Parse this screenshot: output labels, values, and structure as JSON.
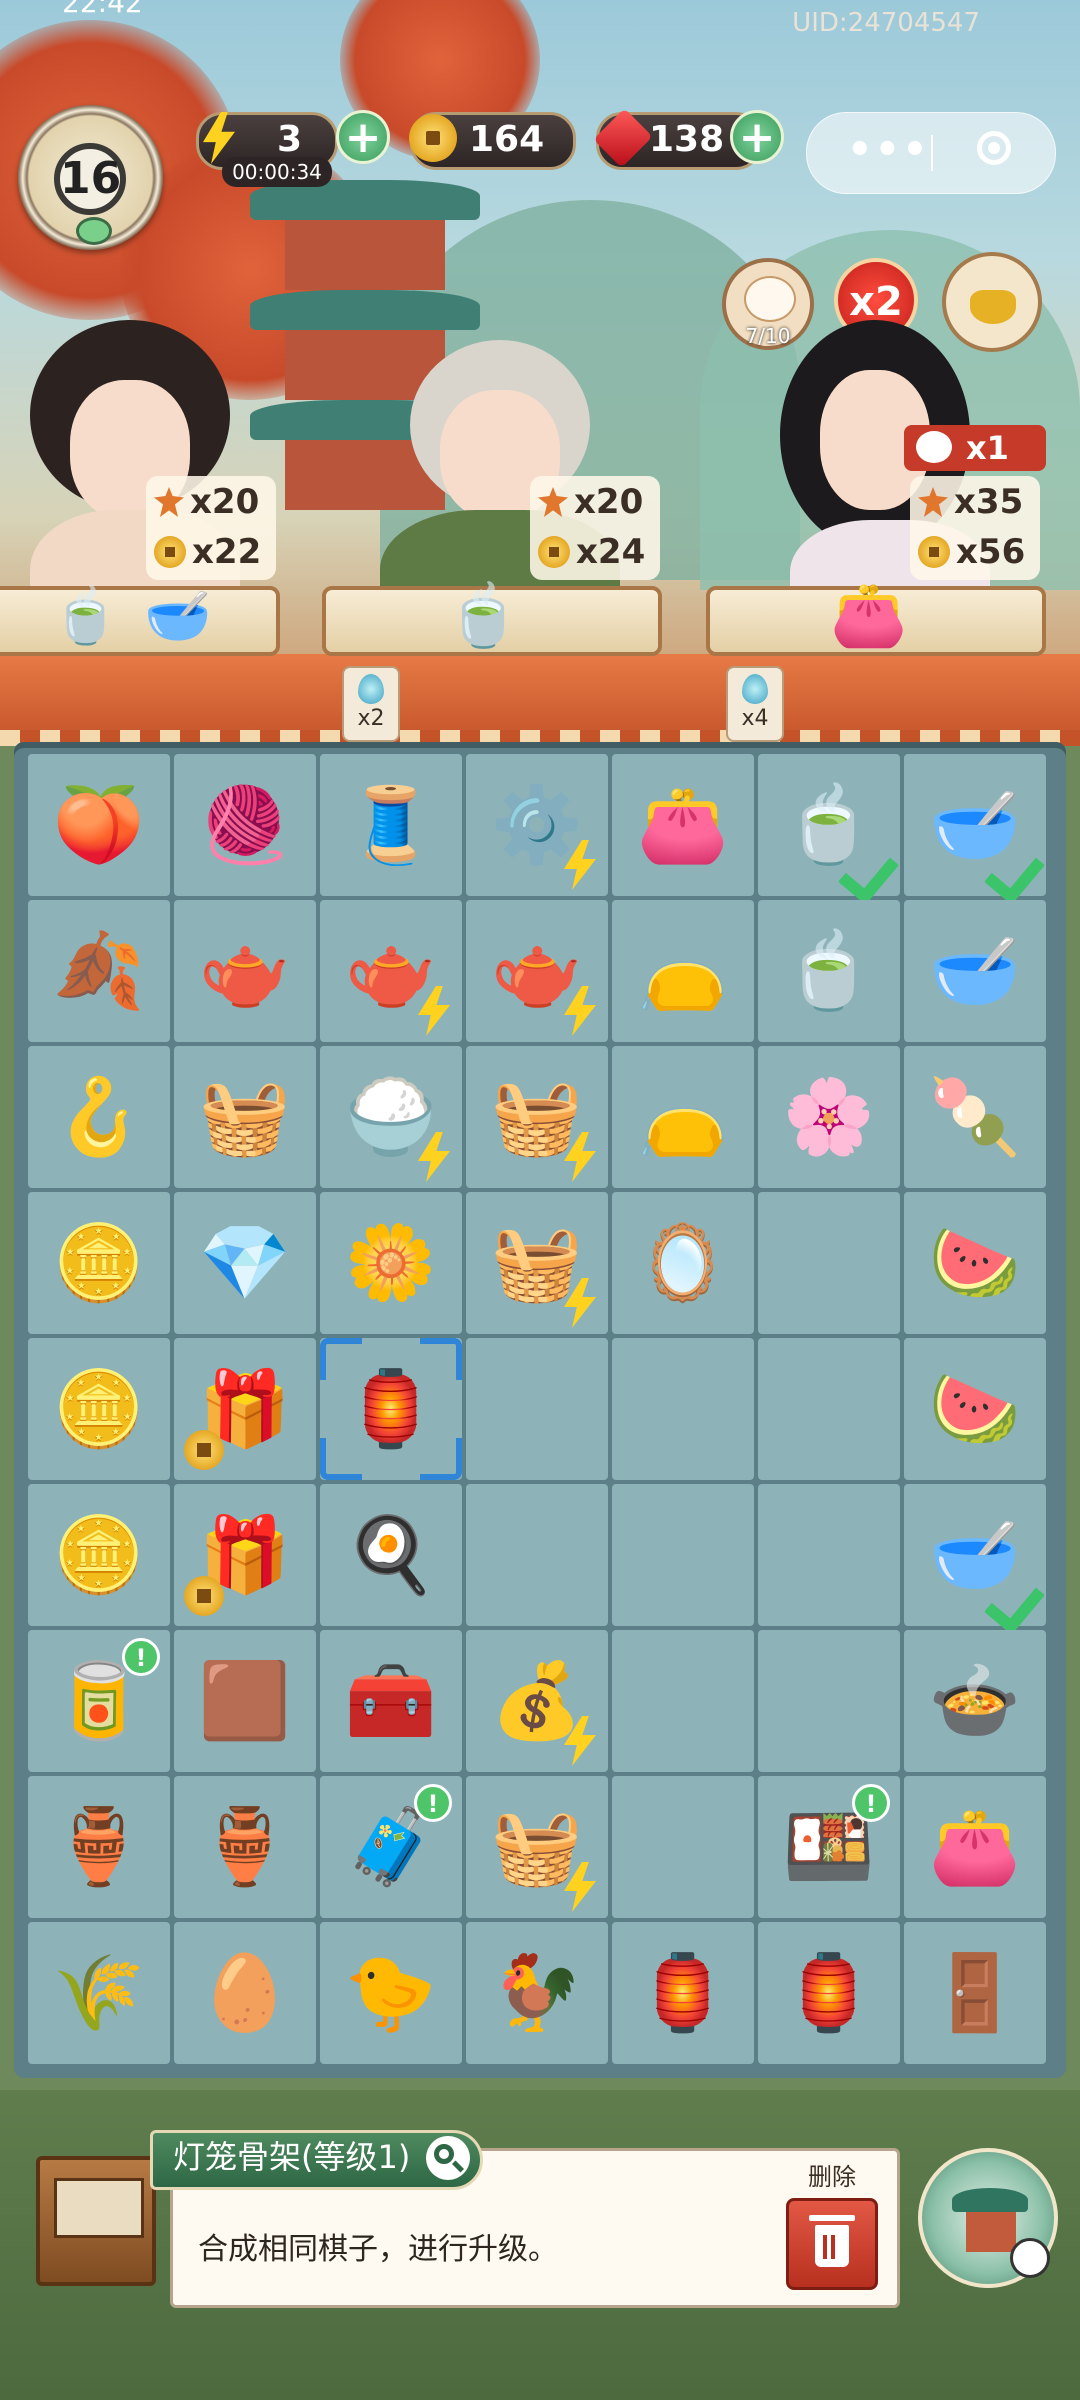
{
  "status": {
    "time": "22:42",
    "uid": "UID:24704547"
  },
  "hud": {
    "level": "16",
    "energy": {
      "value": "3",
      "timer": "00:00:34",
      "icon": "lightning-icon"
    },
    "coins": {
      "value": "164",
      "icon": "coin-icon"
    },
    "gems": {
      "value": "138",
      "icon": "ruby-icon"
    },
    "plus_label": "+",
    "menu": {
      "dots": "•••",
      "icon": "target-circle-icon"
    }
  },
  "boosts": {
    "cat_count": "7/10",
    "multiplier": "x2",
    "x1_tag": "x1"
  },
  "customers": [
    {
      "name": "girl-customer",
      "leaf_reward": "x20",
      "coin_reward": "x22"
    },
    {
      "name": "grandma-customer",
      "leaf_reward": "x20",
      "coin_reward": "x24"
    },
    {
      "name": "lady-customer",
      "leaf_reward": "x35",
      "coin_reward": "x56"
    }
  ],
  "drops": [
    {
      "label": "x2"
    },
    {
      "label": "x4"
    }
  ],
  "board": {
    "rows": [
      [
        {
          "icon": "🍑",
          "name": "peach-rabbit-cake"
        },
        {
          "icon": "🧶",
          "name": "spindle-item"
        },
        {
          "icon": "🧵",
          "name": "silk-spools"
        },
        {
          "icon": "⚙️",
          "name": "spinning-wheel",
          "bolt": true
        },
        {
          "icon": "👛",
          "name": "purple-pouch"
        },
        {
          "icon": "🍵",
          "name": "blue-tea-cup",
          "check": true
        },
        {
          "icon": "🥣",
          "name": "bean-soup-bowl",
          "check": true
        }
      ],
      [
        {
          "icon": "🍂",
          "name": "tea-leaves"
        },
        {
          "icon": "🫖",
          "name": "small-tea-jar"
        },
        {
          "icon": "🫖",
          "name": "teapot",
          "bolt": true
        },
        {
          "icon": "🫖",
          "name": "teapot-set",
          "bolt": true
        },
        {
          "icon": "👝",
          "name": "drawstring-purse"
        },
        {
          "icon": "🍵",
          "name": "chrysanthemum-tea"
        },
        {
          "icon": "🥣",
          "name": "green-bean-soup"
        }
      ],
      [
        {
          "icon": "🪝",
          "name": "jade-pendant"
        },
        {
          "icon": "🧺",
          "name": "bamboo-basket"
        },
        {
          "icon": "🍚",
          "name": "rice-basket",
          "bolt": true
        },
        {
          "icon": "🧺",
          "name": "food-crate",
          "bolt": true
        },
        {
          "icon": "👝",
          "name": "flower-sachet"
        },
        {
          "icon": "🌸",
          "name": "flower-cakes"
        },
        {
          "icon": "🍡",
          "name": "pig-bun"
        }
      ],
      [
        {
          "icon": "🪙",
          "name": "coin-stack"
        },
        {
          "icon": "💎",
          "name": "ruby-gem"
        },
        {
          "icon": "🌼",
          "name": "hairpin-flower"
        },
        {
          "icon": "🧺",
          "name": "sewing-box",
          "bolt": true
        },
        {
          "icon": "🪞",
          "name": "embroidery-hoop"
        },
        {
          "icon": "",
          "name": "empty-cell"
        },
        {
          "icon": "🍉",
          "name": "watermelon-slice"
        }
      ],
      [
        {
          "icon": "🪙",
          "name": "coin-pile"
        },
        {
          "icon": "🎁",
          "name": "mystery-chest",
          "lock": true
        },
        {
          "icon": "🏮",
          "name": "lantern-frame",
          "selected": true
        },
        {
          "icon": "",
          "name": "empty-cell"
        },
        {
          "icon": "",
          "name": "empty-cell"
        },
        {
          "icon": "",
          "name": "empty-cell"
        },
        {
          "icon": "🍉",
          "name": "watermelon-plate"
        }
      ],
      [
        {
          "icon": "🪙",
          "name": "coin-pair"
        },
        {
          "icon": "🎁",
          "name": "mystery-chest-2",
          "lock": true
        },
        {
          "icon": "🍳",
          "name": "fried-egg"
        },
        {
          "icon": "",
          "name": "empty-cell"
        },
        {
          "icon": "",
          "name": "empty-cell"
        },
        {
          "icon": "",
          "name": "empty-cell"
        },
        {
          "icon": "🥣",
          "name": "bean-soup-bowl-2",
          "check": true
        }
      ],
      [
        {
          "icon": "🥫",
          "name": "red-tin",
          "excl": true
        },
        {
          "icon": "🟫",
          "name": "wooden-tray"
        },
        {
          "icon": "🧰",
          "name": "wooden-chest"
        },
        {
          "icon": "💰",
          "name": "treasure-chest",
          "bolt": true
        },
        {
          "icon": "",
          "name": "empty-cell"
        },
        {
          "icon": "",
          "name": "empty-cell"
        },
        {
          "icon": "🍲",
          "name": "tea-cauldron"
        }
      ],
      [
        {
          "icon": "🏺",
          "name": "energy-gourd"
        },
        {
          "icon": "🏺",
          "name": "energy-jar"
        },
        {
          "icon": "🧳",
          "name": "blue-box",
          "excl": true
        },
        {
          "icon": "🧺",
          "name": "yarn-basket",
          "bolt": true
        },
        {
          "icon": "",
          "name": "empty-cell"
        },
        {
          "icon": "🍱",
          "name": "dessert-box",
          "excl": true
        },
        {
          "icon": "👛",
          "name": "tasseled-pouch"
        }
      ],
      [
        {
          "icon": "🌾",
          "name": "grain-bundle"
        },
        {
          "icon": "🥚",
          "name": "egg-nest"
        },
        {
          "icon": "🐤",
          "name": "chick-nest"
        },
        {
          "icon": "🐓",
          "name": "rooster"
        },
        {
          "icon": "🏮",
          "name": "yellow-lantern"
        },
        {
          "icon": "🏮",
          "name": "red-lantern"
        },
        {
          "icon": "🚪",
          "name": "bamboo-blind"
        }
      ]
    ]
  },
  "info": {
    "title": "灯笼骨架(等级1)",
    "description": "合成相同棋子，进行升级。",
    "delete_label": "删除"
  },
  "colors": {
    "board": "#5d7f87",
    "cell": "#8db3b9",
    "accent_green": "#3cc46b",
    "bolt": "#ffd21f"
  }
}
